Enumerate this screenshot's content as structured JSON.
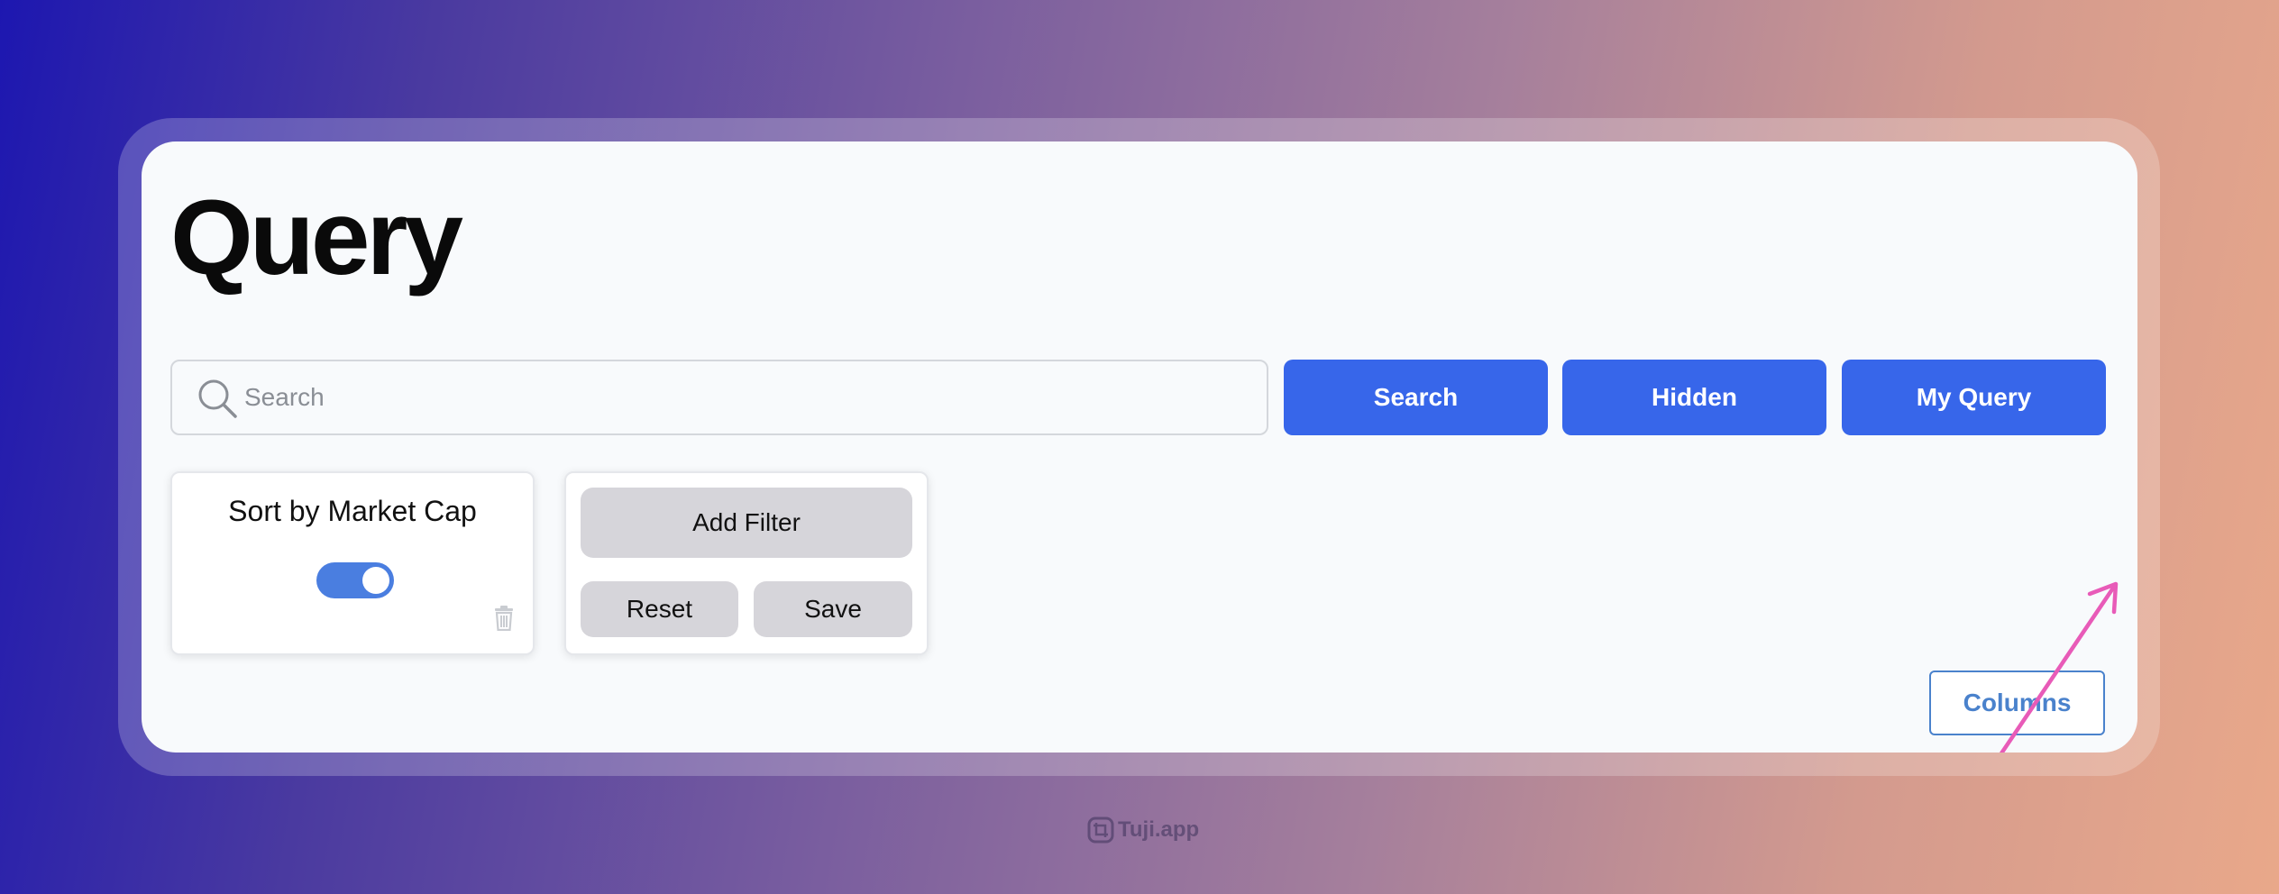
{
  "page": {
    "title": "Query"
  },
  "search": {
    "placeholder": "Search",
    "value": ""
  },
  "toolbar": {
    "search_label": "Search",
    "hidden_label": "Hidden",
    "my_query_label": "My Query"
  },
  "sort_panel": {
    "title": "Sort by Market Cap",
    "toggle_on": true
  },
  "filter_panel": {
    "add_filter_label": "Add Filter",
    "reset_label": "Reset",
    "save_label": "Save"
  },
  "columns_label": "Columns",
  "watermark": "Tuji.app",
  "colors": {
    "primary_button": "#3766ea",
    "toggle_on": "#4a7ee0",
    "annotation_arrow": "#e85bb8",
    "outline_button": "#4a82cc"
  },
  "icons": [
    "search-icon",
    "trash-icon",
    "annotation-arrow-icon",
    "crop-logo-icon"
  ]
}
